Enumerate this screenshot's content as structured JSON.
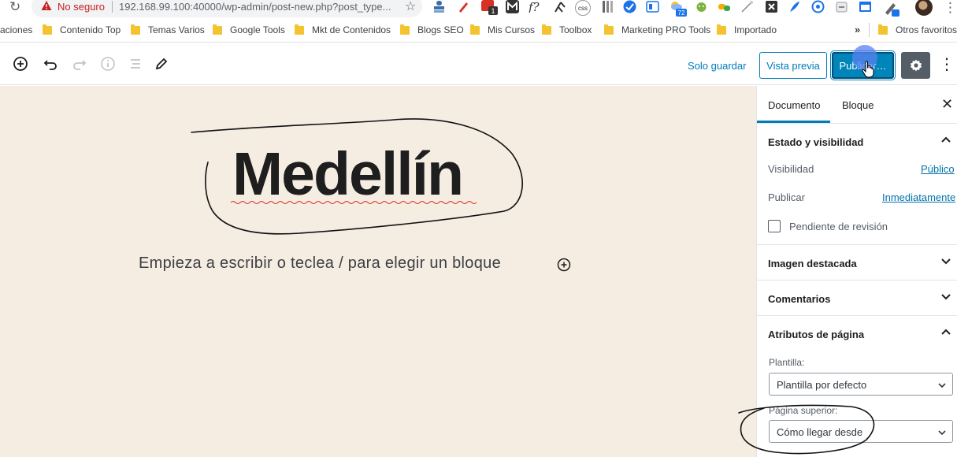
{
  "browser": {
    "reload_icon": "reload-icon",
    "security_warning": "No seguro",
    "url": "192.168.99.100:40000/wp-admin/post-new.php?post_type...",
    "bookmarks": [
      "aciones",
      "Contenido Top",
      "Temas Varios",
      "Google Tools",
      "Mkt de Contenidos",
      "Blogs SEO",
      "Mis Cursos",
      "Toolbox",
      "Marketing PRO Tools",
      "Importado"
    ],
    "more_bookmarks": "»",
    "other_favorites": "Otros favoritos",
    "ext_badge_1": "1",
    "ext_text_f": "f?",
    "ext_text_css": "css",
    "ext_badge_72": "72"
  },
  "toolbar": {
    "save_draft": "Solo guardar",
    "preview": "Vista previa",
    "publish": "Publicar…",
    "colors": {
      "accent": "#007cba",
      "publish_bg": "#0085ba",
      "settings_bg": "#555d66"
    }
  },
  "editor": {
    "title": "Medellín",
    "placeholder": "Empieza a escribir o teclea / para elegir un bloque",
    "canvas_color": "#f5ece2"
  },
  "sidebar": {
    "tabs": {
      "document": "Documento",
      "block": "Bloque"
    },
    "status": {
      "heading": "Estado y visibilidad",
      "visibility_label": "Visibilidad",
      "visibility_value": "Público",
      "publish_label": "Publicar",
      "publish_value": "Inmediatamente",
      "pending_review": "Pendiente de revisión"
    },
    "featured_image": "Imagen destacada",
    "comments": "Comentarios",
    "page_attributes": {
      "heading": "Atributos de página",
      "template_label": "Plantilla:",
      "template_value": "Plantilla por defecto",
      "parent_label": "Página superior:",
      "parent_value": "Cómo llegar desde"
    }
  }
}
